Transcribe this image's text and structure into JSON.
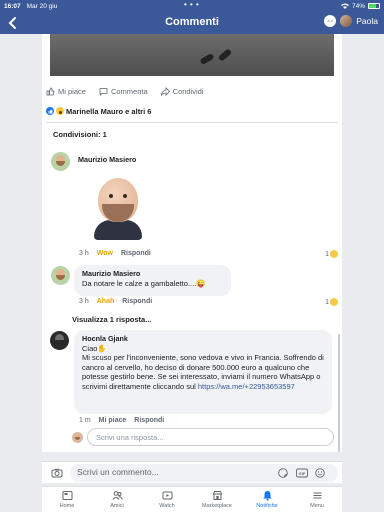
{
  "status_bar": {
    "time": "16:07",
    "date": "Mar 20 giu",
    "battery": "74%",
    "battery_level": 0.74
  },
  "navbar": {
    "title": "Commenti",
    "user_name": "Paola"
  },
  "post": {
    "actions": {
      "like": "Mi piace",
      "comment": "Commenta",
      "share": "Condividi"
    },
    "reactions_text": "Marinella Mauro e altri 6",
    "shares": "Condivisioni: 1"
  },
  "comments": [
    {
      "author": "Maurizio Masiero",
      "time": "3 h",
      "reaction_label": "Wow",
      "reply": "Rispondi",
      "reaction_count": "1"
    },
    {
      "author": "Maurizio Masiero",
      "text": "Da notare le calze a gambaletto....😜",
      "time": "3 h",
      "reaction_label": "Ahah",
      "reply": "Rispondi",
      "reaction_count": "1"
    }
  ],
  "view_replies": "Visualizza 1 risposta...",
  "reply_comment": {
    "author": "Hocnla Gjank",
    "greeting": "Ciao✋",
    "text": "Mi scuso per l'inconveniente, sono vedova e vivo in Francia. Soffrendo di cancro al cervello, ho deciso di donare 500.000 euro a qualcuno che potesse gestirlo bene. Se sei interessato, inviami il numero WhatsApp o scrivimi direttamente cliccando sul ",
    "link": "https://wa.me/+22953653597",
    "time": "1 m",
    "like": "Mi piace",
    "reply": "Rispondi"
  },
  "reply_input": {
    "placeholder": "Scrivi una risposta..."
  },
  "composer": {
    "placeholder": "Scrivi un commento..."
  },
  "tabs": [
    {
      "label": "Home",
      "icon": "home-icon"
    },
    {
      "label": "Amici",
      "icon": "friends-icon"
    },
    {
      "label": "Watch",
      "icon": "watch-icon"
    },
    {
      "label": "Marketplace",
      "icon": "marketplace-icon"
    },
    {
      "label": "Notifiche",
      "icon": "bell-icon",
      "active": true
    },
    {
      "label": "Menu",
      "icon": "menu-icon"
    }
  ],
  "colors": {
    "brand": "#3b5998",
    "accent": "#1877f2",
    "link": "#385898",
    "wow": "#e8a300"
  }
}
